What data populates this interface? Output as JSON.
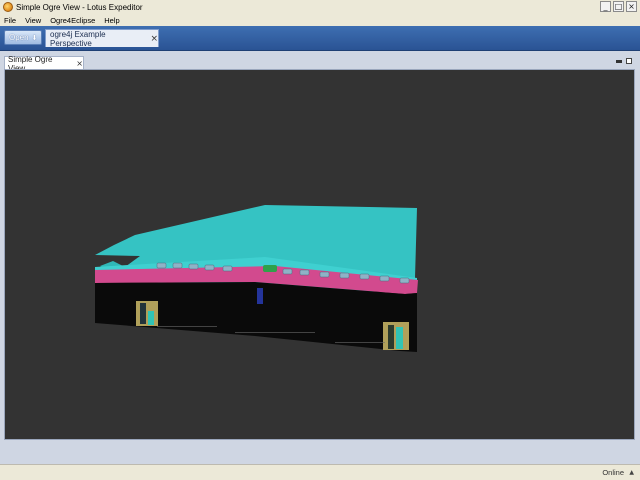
{
  "window": {
    "title": "Simple Ogre View - Lotus Expeditor",
    "controls": [
      "_",
      "□",
      "×"
    ]
  },
  "menubar": {
    "items": [
      "File",
      "View",
      "Ogre4Eclipse",
      "Help"
    ]
  },
  "toolbar": {
    "open_label": "Open",
    "open_arrow": "⬇",
    "perspective_tab": "ogre4j Example Perspective",
    "close_glyph": "×"
  },
  "view": {
    "tab_label": "Simple Ogre View",
    "close_glyph": "×"
  },
  "status": {
    "text": "Online",
    "caret": "▲"
  },
  "colors": {
    "canvas_bg": "#333333",
    "roof_cyan": "#35c3c3",
    "roof_rim_magenta": "#d24a8e",
    "toolbar_blue": "#2f5ea3"
  }
}
